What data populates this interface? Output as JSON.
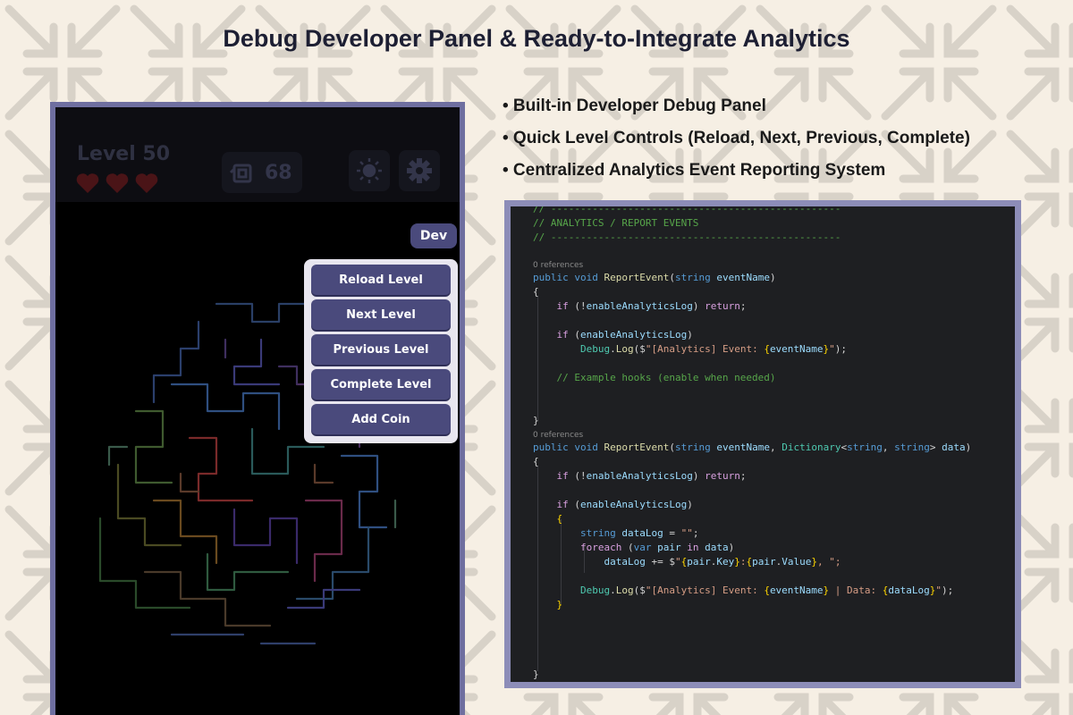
{
  "headline": "Debug Developer Panel & Ready-to-Integrate Analytics",
  "game": {
    "level_label": "Level 50",
    "lives": 3,
    "moves_count": "68",
    "dev_button_label": "Dev",
    "dev_menu": [
      "Reload Level",
      "Next Level",
      "Previous Level",
      "Complete Level",
      "Add Coin"
    ]
  },
  "bullets": [
    "• Built-in Developer Debug Panel",
    "• Quick Level Controls (Reload, Next, Previous, Complete)",
    "• Centralized Analytics Event Reporting System"
  ],
  "code": {
    "l1": "// -------------------------------------------------",
    "l2": "// ANALYTICS / REPORT EVENTS",
    "l3": "// -------------------------------------------------",
    "ref1": "0 references",
    "ref2": "0 references",
    "kw_public": "public",
    "kw_void": "void",
    "kw_string": "string",
    "kw_if": "if",
    "kw_return": "return",
    "kw_foreach": "foreach",
    "kw_var": "var",
    "kw_in": "in",
    "method_report": "ReportEvent",
    "method_log": "Log",
    "type_debug": "Debug",
    "type_dict": "Dictionary",
    "param_eventName": "eventName",
    "param_data": "data",
    "field_enable": "enableAnalyticsLog",
    "var_dataLog": "dataLog",
    "var_pair": "pair",
    "str_event": "\"[Analytics] Event: ",
    "str_event_data": "\"[Analytics] Event: ",
    "str_data_sep": " | Data: ",
    "str_empty": "\"\"",
    "str_pair_sep": ":",
    "str_pair_end": ", \";",
    "comment_hooks": "// Example hooks (enable when needed)",
    "prop_key": "Key",
    "prop_value": "Value"
  },
  "colors": {
    "frame": "#6f6fa0",
    "button": "#4a4a7c",
    "background": "#f6efe4"
  }
}
